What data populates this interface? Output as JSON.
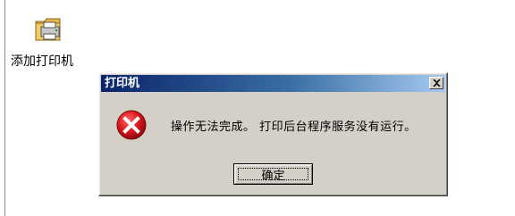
{
  "desktop": {
    "add_printer_label": "添加打印机",
    "add_printer_icon": "printer-folder-icon"
  },
  "dialog": {
    "title": "打印机",
    "close_glyph": "×",
    "message": "操作无法完成。 打印后台程序服务没有运行。",
    "icon": "error-icon",
    "ok_label": "确定",
    "colors": {
      "titlebar_start": "#0a246a",
      "titlebar_end": "#a6caf0",
      "face": "#d4d0c8",
      "error_red": "#d9141c"
    }
  }
}
